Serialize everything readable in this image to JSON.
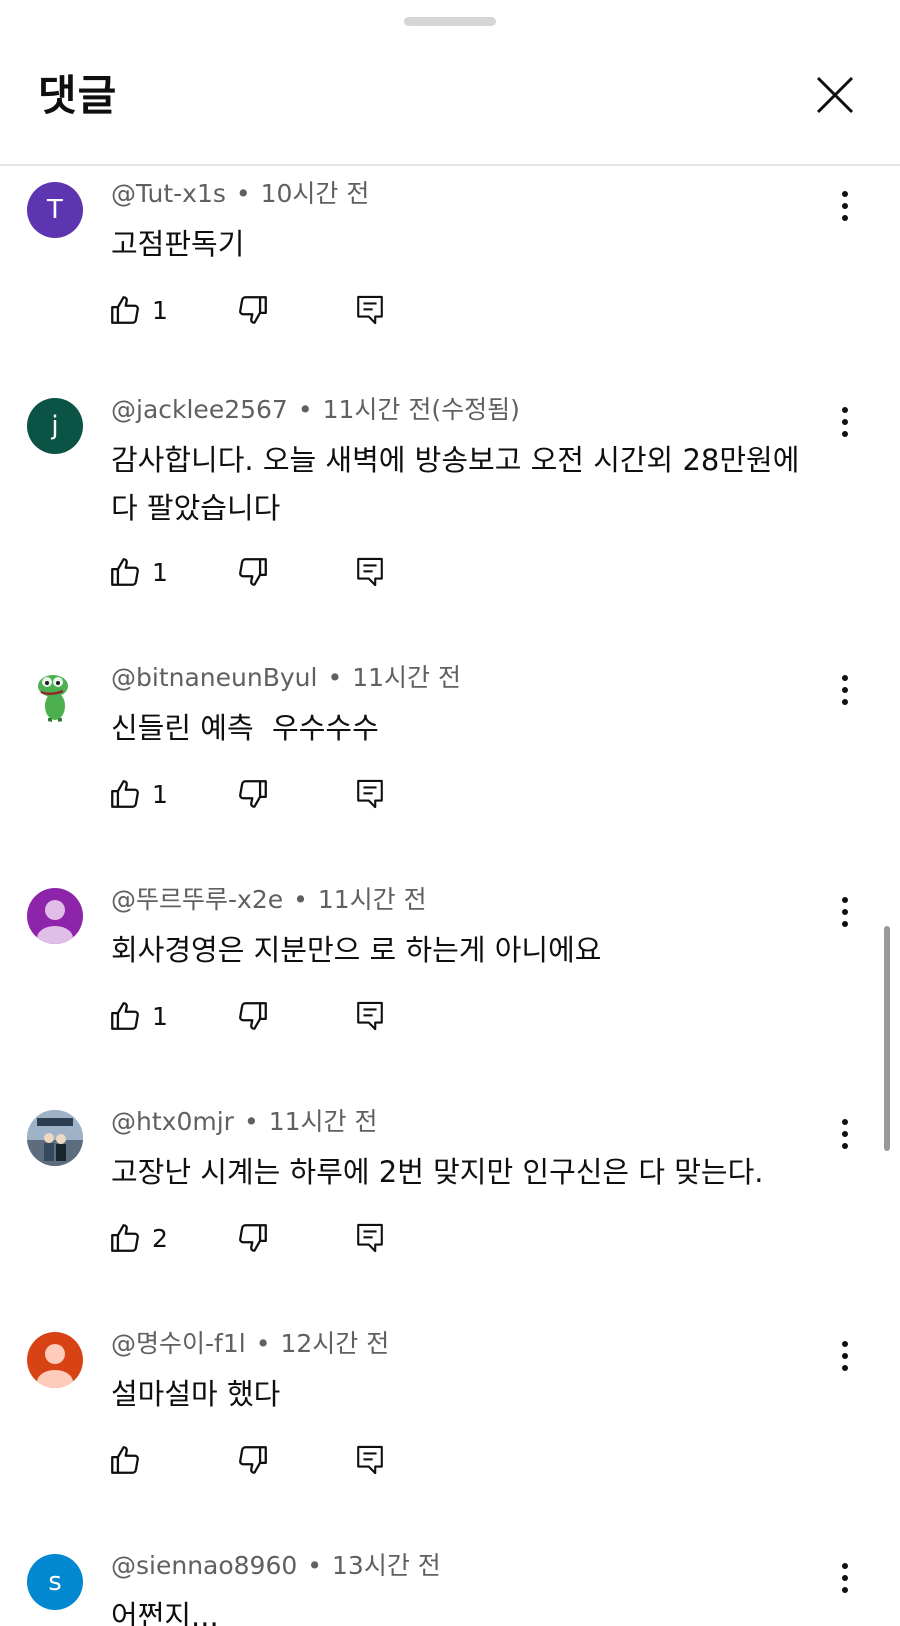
{
  "header": {
    "title": "댓글"
  },
  "icons": {
    "close": "close-icon",
    "like": "thumbs-up-icon",
    "dislike": "thumbs-down-icon",
    "reply": "reply-icon",
    "more": "more-vertical-icon"
  },
  "comments": [
    {
      "author": "@Tut-x1s",
      "time": "10시간 전",
      "text": "고점판독기",
      "likes": "1",
      "avatar_letter": "T",
      "avatar_color": "#5e35b1"
    },
    {
      "author": "@jacklee2567",
      "time": "11시간 전(수정됨)",
      "text": "감사합니다. 오늘 새벽에 방송보고 오전 시간외 28만원에 다 팔았습니다",
      "likes": "1",
      "avatar_letter": "j",
      "avatar_color": "#0b5345"
    },
    {
      "author": "@bitnaneunByul",
      "time": "11시간 전",
      "text": "신들린 예측  우수수수",
      "likes": "1",
      "avatar_letter": "",
      "avatar_color": "#ffffff"
    },
    {
      "author": "@뚜르뚜루-x2e",
      "time": "11시간 전",
      "text": "회사경영은 지분만으 로 하는게 아니에요",
      "likes": "1",
      "avatar_letter": "",
      "avatar_color": "#8e24aa"
    },
    {
      "author": "@htx0mjr",
      "time": "11시간 전",
      "text": "고장난 시계는 하루에 2번 맞지만 인구신은 다 맞는다.",
      "likes": "2",
      "avatar_letter": "",
      "avatar_color": "#7a8a9a"
    },
    {
      "author": "@명수이-f1l",
      "time": "12시간 전",
      "text": "설마설마 했다",
      "likes": "",
      "avatar_letter": "",
      "avatar_color": "#d84315"
    },
    {
      "author": "@siennao8960",
      "time": "13시간 전",
      "text": "어쩐지...",
      "likes": "",
      "avatar_letter": "s",
      "avatar_color": "#0288d1"
    }
  ]
}
